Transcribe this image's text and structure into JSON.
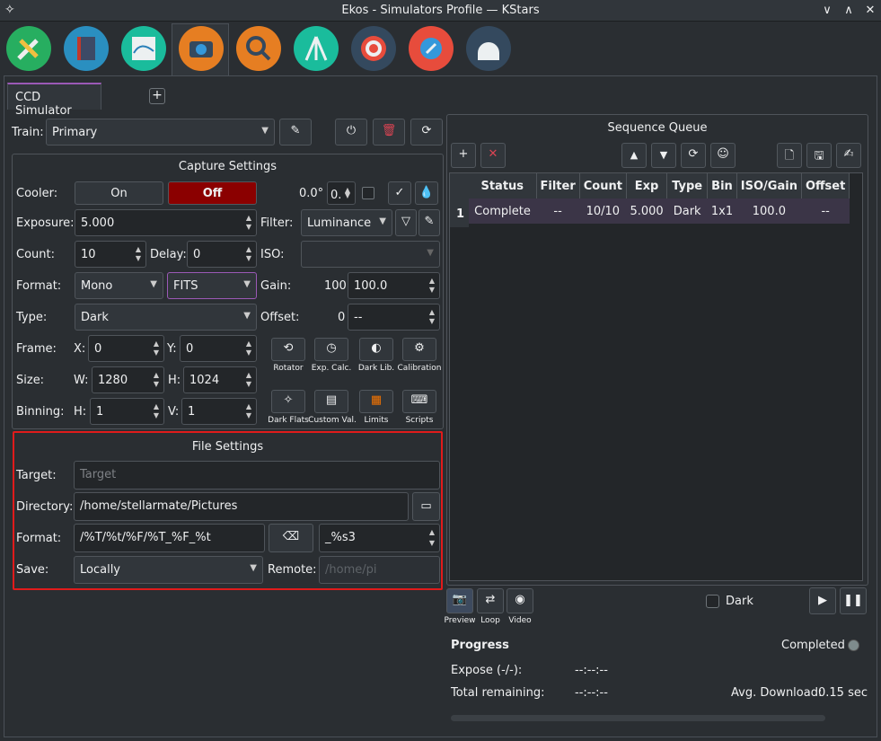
{
  "window": {
    "title": "Ekos - Simulators Profile — KStars",
    "min": "∨",
    "max": "∧",
    "close": "✕"
  },
  "tabs": {
    "ccd": "CCD Simulator",
    "add": "+"
  },
  "train": {
    "label": "Train:",
    "value": "Primary"
  },
  "capture": {
    "title": "Capture Settings",
    "cooler_label": "Cooler:",
    "cooler_on": "On",
    "cooler_off": "Off",
    "temp": "0.0°",
    "temp_set": "0.",
    "exposure_label": "Exposure:",
    "exposure": "5.000",
    "filter_label": "Filter:",
    "filter": "Luminance",
    "count_label": "Count:",
    "count": "10",
    "delay_label": "Delay:",
    "delay": "0",
    "iso_label": "ISO:",
    "format_label": "Format:",
    "format_color": "Mono",
    "format_type": "FITS",
    "gain_label": "Gain:",
    "gain_current": "100",
    "gain": "100.0",
    "type_label": "Type:",
    "type": "Dark",
    "offset_label": "Offset:",
    "offset_current": "0",
    "offset": "--",
    "frame_label": "Frame:",
    "x_label": "X:",
    "x": "0",
    "y_label": "Y:",
    "y": "0",
    "size_label": "Size:",
    "w_label": "W:",
    "w": "1280",
    "h_label": "H:",
    "h": "1024",
    "binning_label": "Binning:",
    "bh_label": "H:",
    "bh": "1",
    "bv_label": "V:",
    "bv": "1",
    "tools": [
      "Rotator",
      "Exp. Calc.",
      "Dark Lib.",
      "Calibration",
      "Dark Flats",
      "Custom Val.",
      "Limits",
      "Scripts"
    ]
  },
  "file": {
    "title": "File Settings",
    "target_label": "Target:",
    "target_placeholder": "Target",
    "dir_label": "Directory:",
    "dir": "/home/stellarmate/Pictures",
    "format_label": "Format:",
    "format": "/%T/%t/%F/%T_%F_%t",
    "suffix": "_%s3",
    "save_label": "Save:",
    "save": "Locally",
    "remote_label": "Remote:",
    "remote_placeholder": "/home/pi"
  },
  "queue": {
    "title": "Sequence Queue",
    "columns": [
      "Status",
      "Filter",
      "Count",
      "Exp",
      "Type",
      "Bin",
      "ISO/Gain",
      "Offset"
    ],
    "rows": [
      {
        "num": "1",
        "cells": [
          "Complete",
          "--",
          "10/10",
          "5.000",
          "Dark",
          "1x1",
          "100.0",
          "--"
        ]
      }
    ]
  },
  "modes": {
    "preview": "Preview",
    "loop": "Loop",
    "video": "Video",
    "dark": "Dark"
  },
  "progress": {
    "title": "Progress",
    "status": "Completed",
    "expose_label": "Expose (-/-):",
    "expose": "--:--:--",
    "remaining_label": "Total remaining:",
    "remaining": "--:--:--",
    "download": "Avg. Download:",
    "download_value": "0.15 sec"
  },
  "colors": {
    "accent": "#9b59b6",
    "off_red": "#8b0000",
    "highlight": "#e01b1b"
  }
}
